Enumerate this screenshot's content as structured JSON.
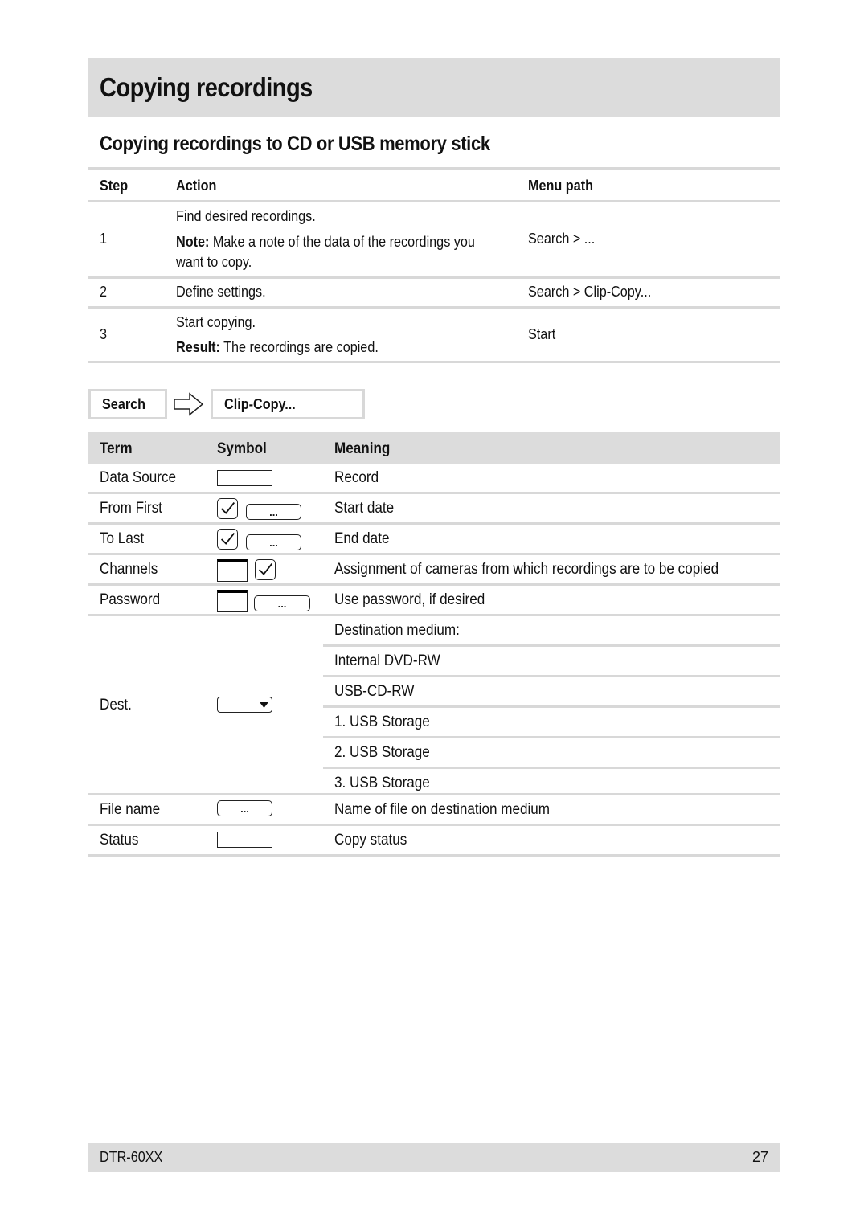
{
  "page": {
    "title": "Copying recordings",
    "subtitle": "Copying recordings to CD or USB memory stick"
  },
  "steps_table": {
    "headers": {
      "step": "Step",
      "action": "Action",
      "menu_path": "Menu path"
    },
    "rows": [
      {
        "step": "1",
        "action_lines": [
          "Find desired recordings."
        ],
        "note_label": "Note:",
        "note_text": " Make a note of the data of the recordings you",
        "note_text2": "want to copy.",
        "menu_path": "Search > ..."
      },
      {
        "step": "2",
        "action_lines": [
          "Define settings."
        ],
        "menu_path": "Search > Clip-Copy..."
      },
      {
        "step": "3",
        "action_lines": [
          "Start copying."
        ],
        "result_label": "Result:",
        "result_text": " The recordings are copied.",
        "menu_path": "Start"
      }
    ]
  },
  "nav_path": {
    "from": "Search",
    "arrow_icon": "right-arrow-icon",
    "to": "Clip-Copy..."
  },
  "terms_table": {
    "headers": {
      "term": "Term",
      "symbol": "Symbol",
      "meaning": "Meaning"
    },
    "rows": [
      {
        "term": "Data Source",
        "symbol": "text-field",
        "meaning": "Record"
      },
      {
        "term": "From First",
        "symbol": "checkbox + ellipsis-button",
        "dots": "...",
        "meaning": "Start date"
      },
      {
        "term": "To Last",
        "symbol": "checkbox + ellipsis-button",
        "dots": "...",
        "meaning": "End date"
      },
      {
        "term": "Channels",
        "symbol": "window + checkbox",
        "meaning": "Assignment of cameras from which recordings are to be copied"
      },
      {
        "term": "Password",
        "symbol": "window + ellipsis-button",
        "dots": "...",
        "meaning": "Use password, if desired"
      },
      {
        "term": "Dest.",
        "symbol": "dropdown",
        "meaning": "Destination medium:",
        "options": [
          "Internal DVD-RW",
          "USB-CD-RW",
          "1. USB Storage",
          "2. USB Storage",
          "3. USB Storage"
        ]
      },
      {
        "term": "File name",
        "symbol": "ellipsis-button",
        "dots": "...",
        "meaning": "Name of file on destination medium"
      },
      {
        "term": "Status",
        "symbol": "text-field",
        "meaning": "Copy status"
      }
    ]
  },
  "footer": {
    "model": "DTR-60XX",
    "page_number": "27"
  }
}
